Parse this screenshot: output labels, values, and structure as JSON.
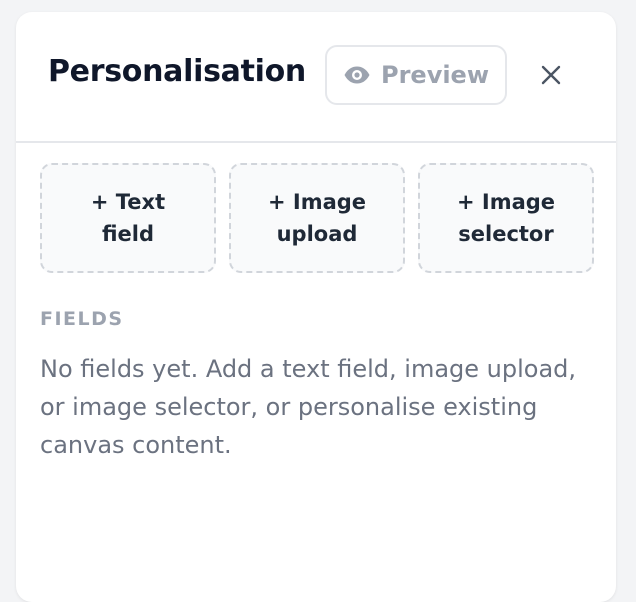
{
  "panel": {
    "title": "Personalisation",
    "preview_label": "Preview",
    "preview_icon": "eye-icon",
    "close_icon": "close-icon"
  },
  "add_buttons": [
    {
      "label": "+ Text field"
    },
    {
      "label": "+ Image upload"
    },
    {
      "label": "+ Image selector"
    }
  ],
  "fields": {
    "section_label": "FIELDS",
    "empty_text": "No fields yet. Add a text field, image upload, or image selector, or personalise existing canvas content."
  },
  "colors": {
    "title": "#0f172a",
    "muted": "#9ca3af",
    "body_text": "#6b7280",
    "border": "#e5e7eb",
    "dashed_border": "#d1d5db"
  }
}
